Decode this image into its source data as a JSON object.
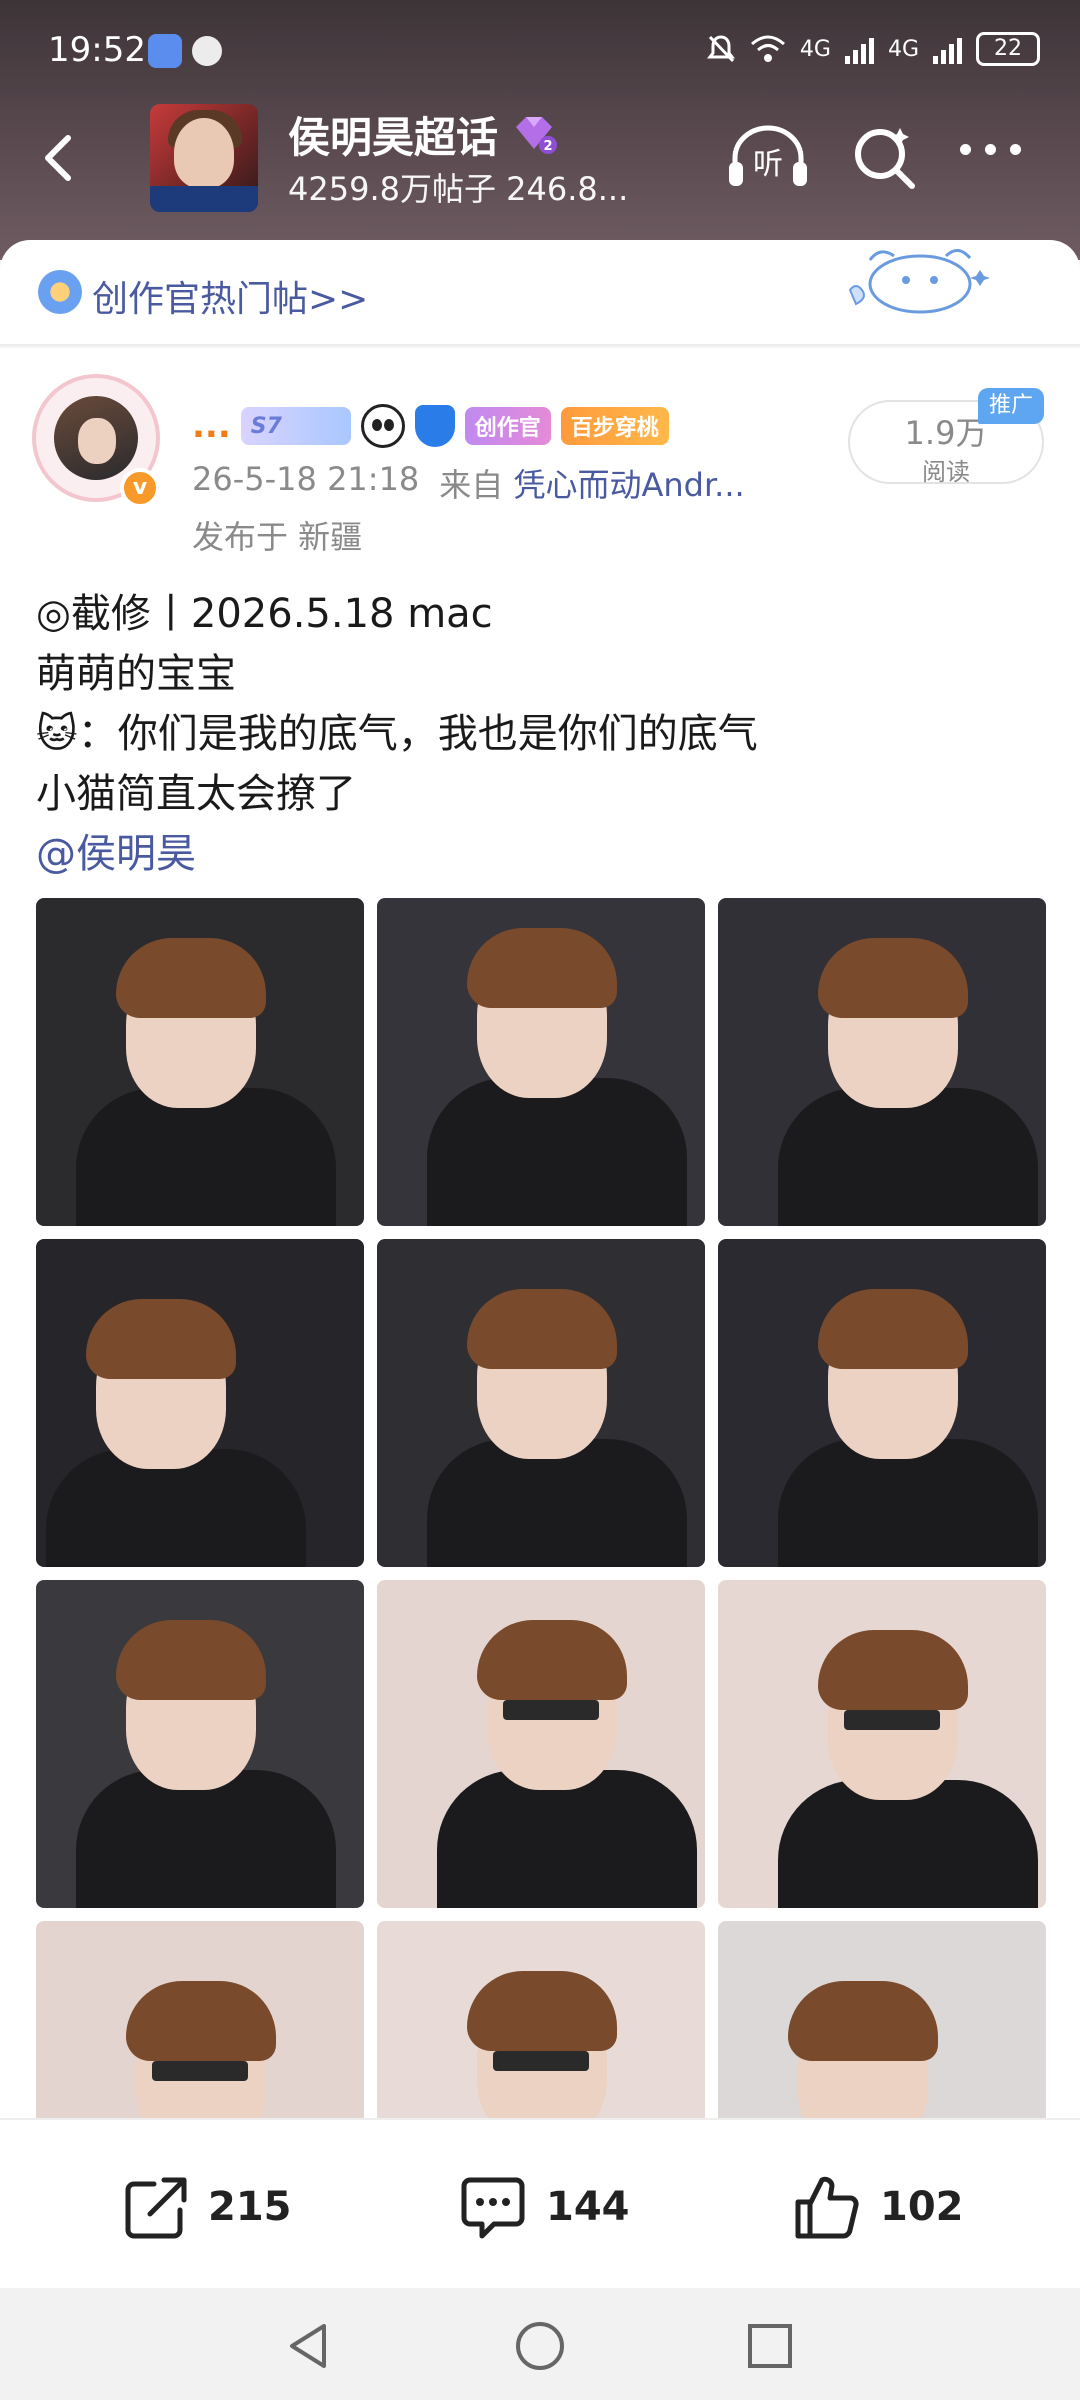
{
  "status_bar": {
    "time": "19:52",
    "battery": "22",
    "network_left": "4G",
    "network_right": "4G"
  },
  "header": {
    "topic_title": "侯明昊超话",
    "topic_stats": "4259.8万帖子 246.8...",
    "listen_label": "听"
  },
  "banner": {
    "text": "创作官热门帖>>"
  },
  "post": {
    "author_name": "...",
    "badges": {
      "s7": "S7",
      "creator": "创作官",
      "bai": "百步穿桃"
    },
    "timestamp": "26-5-18 21:18",
    "source_prefix": "来自",
    "source": "凭心而动Andr...",
    "location": "发布于 新疆",
    "read_count": "1.9万",
    "read_label": "阅读",
    "ad_tag": "推广",
    "lines": [
      "◎截修丨2026.5.18 mac",
      "萌萌的宝宝",
      "🐱：你们是我的底气，我也是你们的底气",
      "小猫简直太会撩了"
    ],
    "mention": "@侯明昊",
    "image_count": 12
  },
  "actions": {
    "share_count": "215",
    "comment_count": "144",
    "like_count": "102"
  },
  "colors": {
    "accent_blue": "#4a5aa0",
    "author_orange": "#f07c18",
    "header_dark": "#3d3438"
  }
}
